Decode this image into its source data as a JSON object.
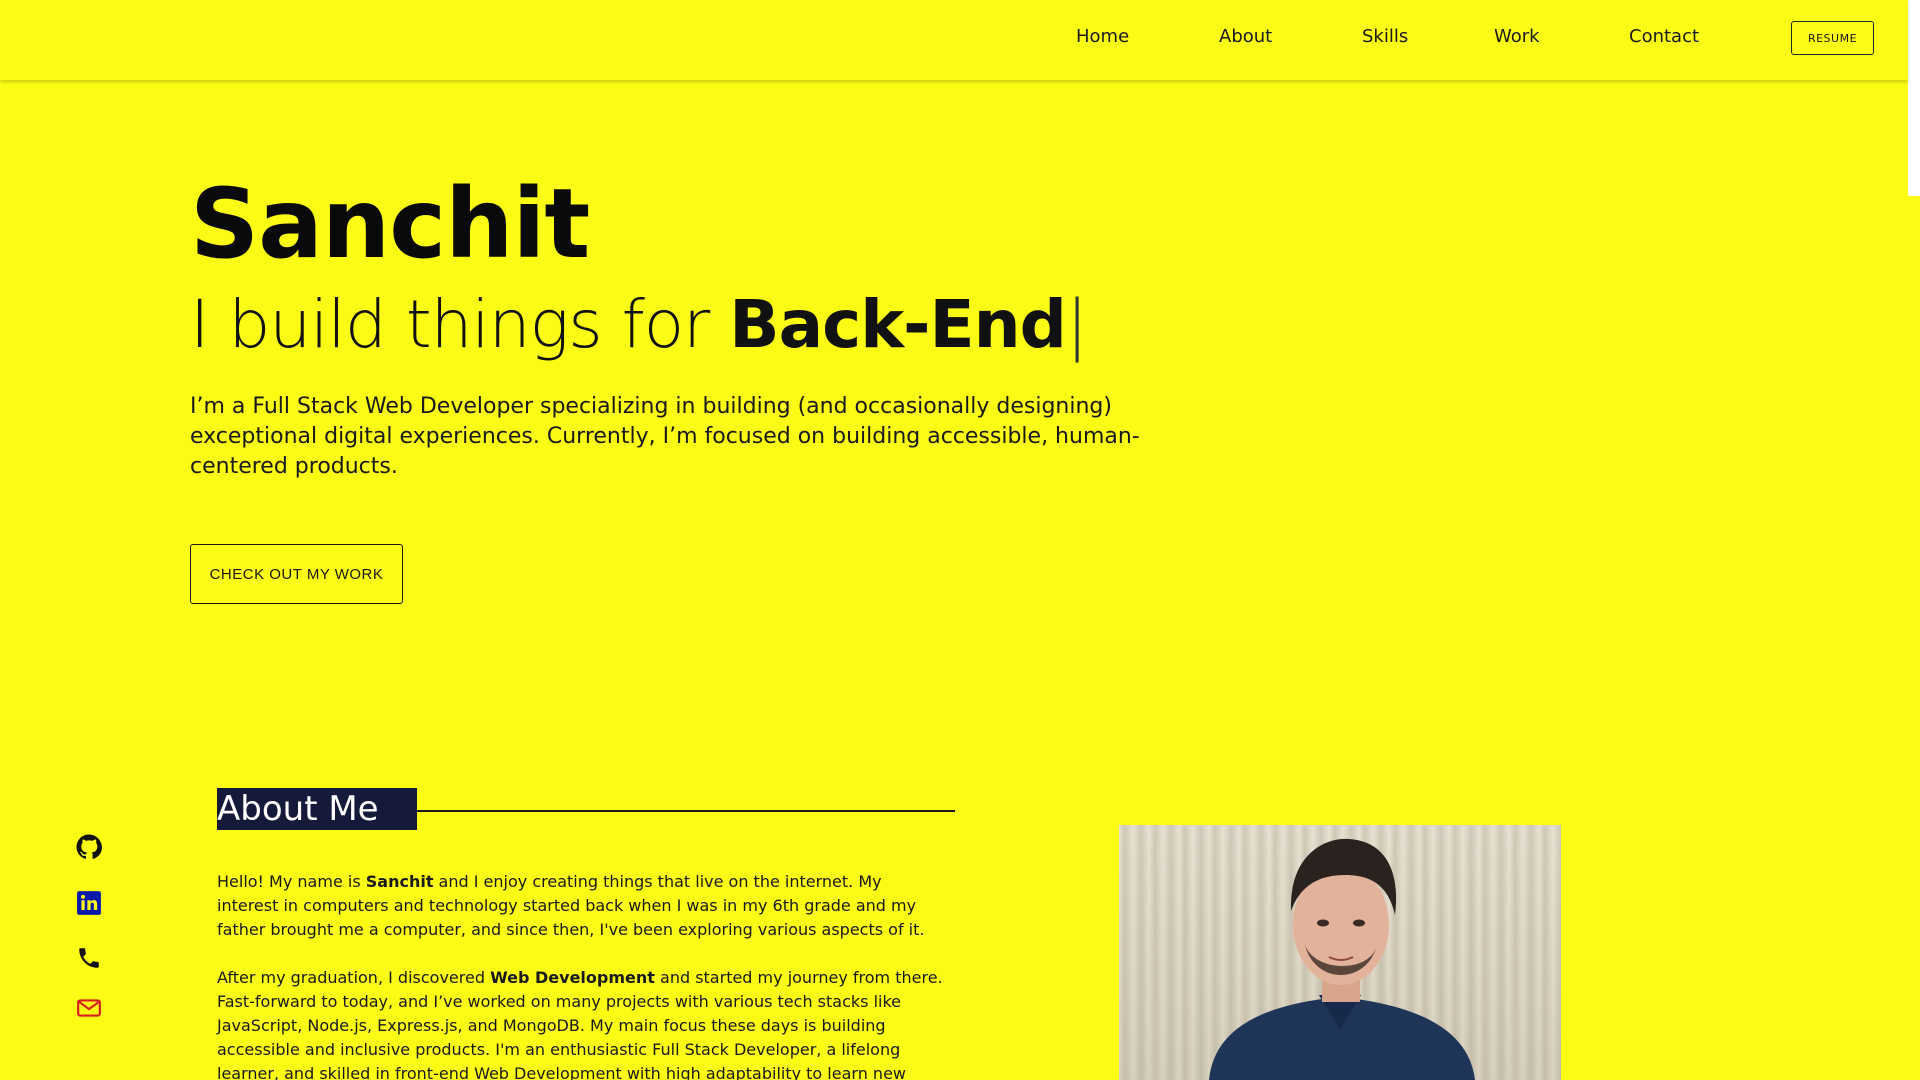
{
  "nav": {
    "links": [
      "Home",
      "About",
      "Skills",
      "Work",
      "Contact"
    ],
    "resume_label": "RESUME"
  },
  "hero": {
    "name": "Sanchit",
    "tagline_prefix": "I build things for ",
    "tagline_accent": "Back-End",
    "tagline_cursor": "|",
    "description": "I’m a Full Stack Web Developer specializing in building (and occasionally designing) exceptional digital experiences. Currently, I’m focused on building accessible, human-centered products.",
    "cta_label": "CHECK OUT MY WORK"
  },
  "about": {
    "heading": "About Me",
    "p1_before": "Hello! My name is ",
    "p1_bold": "Sanchit",
    "p1_after": " and I enjoy creating things that live on the internet. My interest in computers and technology started back when I was in my 6th grade and my father brought me a computer, and since then, I've been exploring various aspects of it.",
    "p2_before": "After my graduation, I discovered ",
    "p2_bold": "Web Development",
    "p2_after": " and started my journey from there. Fast-forward to today, and I’ve worked on many projects with various tech stacks like JavaScript, Node.js, Express.js, and MongoDB. My main focus these days is building accessible and inclusive products. I'm an enthusiastic Full Stack Developer, a lifelong learner, and skilled in front-end Web Development with high adaptability to learn new"
  },
  "social": {
    "icons": [
      "github-icon",
      "linkedin-icon",
      "phone-icon",
      "mail-icon"
    ]
  },
  "colors": {
    "background": "#fbfb15",
    "heading_bg": "#151a3a",
    "linkedin": "#0a1aa8",
    "mail": "#d81e1e"
  }
}
